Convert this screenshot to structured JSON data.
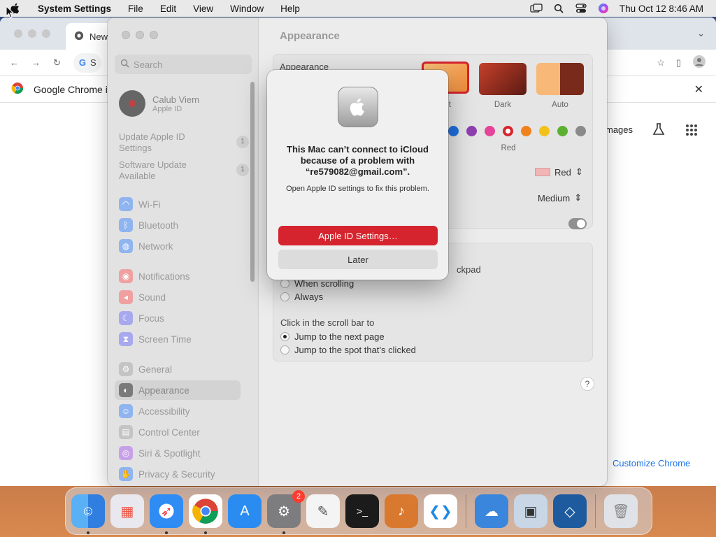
{
  "menubar": {
    "app_name": "System Settings",
    "menus": [
      "File",
      "Edit",
      "View",
      "Window",
      "Help"
    ],
    "clock": "Thu Oct 12  8:46 AM"
  },
  "chrome": {
    "tab_title": "New",
    "omnibox_text": "S",
    "infobar_text": "Google Chrome i",
    "images_link": "mages",
    "customize_button": "Customize Chrome"
  },
  "settings": {
    "search_placeholder": "Search",
    "account": {
      "name": "Calub Viem",
      "subtitle": "Apple ID"
    },
    "notices": [
      {
        "label": "Update Apple ID Settings",
        "count": "1"
      },
      {
        "label": "Software Update Available",
        "count": "1"
      }
    ],
    "nav": [
      {
        "label": "Wi-Fi",
        "icon": "wifi-icon",
        "color": "#3b82f6"
      },
      {
        "label": "Bluetooth",
        "icon": "bluetooth-icon",
        "color": "#3b82f6"
      },
      {
        "label": "Network",
        "icon": "network-icon",
        "color": "#3b82f6"
      },
      {
        "label": "Notifications",
        "icon": "notifications-icon",
        "color": "#ef4444"
      },
      {
        "label": "Sound",
        "icon": "sound-icon",
        "color": "#ef4444"
      },
      {
        "label": "Focus",
        "icon": "focus-icon",
        "color": "#6366f1"
      },
      {
        "label": "Screen Time",
        "icon": "screen-time-icon",
        "color": "#6366f1"
      },
      {
        "label": "General",
        "icon": "gear-icon",
        "color": "#9ca3af"
      },
      {
        "label": "Appearance",
        "icon": "appearance-icon",
        "color": "#374151"
      },
      {
        "label": "Accessibility",
        "icon": "accessibility-icon",
        "color": "#3b82f6"
      },
      {
        "label": "Control Center",
        "icon": "control-center-icon",
        "color": "#9ca3af"
      },
      {
        "label": "Siri & Spotlight",
        "icon": "siri-icon",
        "color": "#a855f7"
      },
      {
        "label": "Privacy & Security",
        "icon": "hand-icon",
        "color": "#3b82f6"
      }
    ],
    "content_title": "Appearance",
    "appearance_label": "Appearance",
    "modes": [
      {
        "label": "ght",
        "selected": true
      },
      {
        "label": "Dark",
        "selected": false
      },
      {
        "label": "Auto",
        "selected": false
      }
    ],
    "accent_selected_label": "Red",
    "accent_colors": [
      "#1f6fe0",
      "#8e3fb0",
      "#e6439a",
      "#d5242d",
      "#f0821e",
      "#f3c21a",
      "#5cb030",
      "#8a8a8a"
    ],
    "highlight_value": "Red",
    "sidebar_icon_size_value": "Medium",
    "scroll_partial_text": "ckpad",
    "scroll_options": [
      {
        "label": "When scrolling",
        "checked": false
      },
      {
        "label": "Always",
        "checked": false
      }
    ],
    "click_scrollbar_label": "Click in the scroll bar to",
    "click_options": [
      {
        "label": "Jump to the next page",
        "checked": true
      },
      {
        "label": "Jump to the spot that’s clicked",
        "checked": false
      }
    ],
    "help_label": "?"
  },
  "alert": {
    "message": "This Mac can’t connect to iCloud because of a problem with “re579082@gmail.com”.",
    "informative": "Open Apple ID settings to fix this problem.",
    "primary_button": "Apple ID Settings…",
    "secondary_button": "Later"
  },
  "dock": {
    "apps": [
      {
        "name": "Finder",
        "icon": "finder-icon",
        "color": "#3b8ff0",
        "running": true
      },
      {
        "name": "Launchpad",
        "icon": "launchpad-icon",
        "color": "#e8e8ee",
        "running": false
      },
      {
        "name": "Safari",
        "icon": "safari-icon",
        "color": "#2f8cf5",
        "running": true
      },
      {
        "name": "Chrome",
        "icon": "chrome-icon",
        "color": "#ffffff",
        "running": true
      },
      {
        "name": "App Store",
        "icon": "app-store-icon",
        "color": "#2a8cf0",
        "running": false
      },
      {
        "name": "System Settings",
        "icon": "system-settings-icon",
        "color": "#7d7d80",
        "running": true,
        "badge": "2"
      },
      {
        "name": "TextEdit",
        "icon": "textedit-icon",
        "color": "#f4f4f4",
        "running": false
      },
      {
        "name": "Terminal",
        "icon": "terminal-icon",
        "color": "#1b1b1b",
        "running": false
      },
      {
        "name": "GarageBand",
        "icon": "garageband-icon",
        "color": "#d9792f",
        "running": false
      },
      {
        "name": "VS Code",
        "icon": "vscode-icon",
        "color": "#ffffff",
        "running": false
      },
      {
        "name": "Weather",
        "icon": "weather-icon",
        "color": "#3a86dc",
        "running": false
      },
      {
        "name": "Preview",
        "icon": "preview-icon",
        "color": "#c8d6e6",
        "running": false
      },
      {
        "name": "VirtualBox",
        "icon": "virtualbox-icon",
        "color": "#1d5b9e",
        "running": false
      },
      {
        "name": "Trash",
        "icon": "trash-icon",
        "color": "#dfe3e8",
        "running": false
      }
    ]
  }
}
